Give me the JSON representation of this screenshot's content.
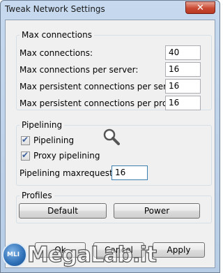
{
  "window": {
    "title": "Tweak Network Settings",
    "close_glyph": "✕"
  },
  "max_connections": {
    "group_title": "Max connections",
    "rows": [
      {
        "label": "Max connections:",
        "value": "40"
      },
      {
        "label": "Max connections per server:",
        "value": "16"
      },
      {
        "label": "Max persistent connections per server:",
        "value": "16"
      },
      {
        "label": "Max persistent connections per proxy:",
        "value": "16"
      }
    ]
  },
  "pipelining": {
    "group_title": "Pipelining",
    "pipelining_label": "Pipelining",
    "pipelining_checked": true,
    "proxy_pipelining_label": "Proxy pipelining",
    "proxy_pipelining_checked": true,
    "maxrequests_label": "Pipelining maxrequests:",
    "maxrequests_value": "16",
    "icon": "magnifier-icon"
  },
  "profiles": {
    "group_title": "Profiles",
    "default_label": "Default",
    "power_label": "Power"
  },
  "footer": {
    "ok_label": "Ok",
    "cancel_label": "Cancel",
    "apply_label": "Apply"
  },
  "watermark": {
    "badge": "MLI",
    "text": "MegaLab.it"
  },
  "colors": {
    "titlebar": "#c6d9ee",
    "close": "#c94a33",
    "client": "#f0f0f0"
  }
}
